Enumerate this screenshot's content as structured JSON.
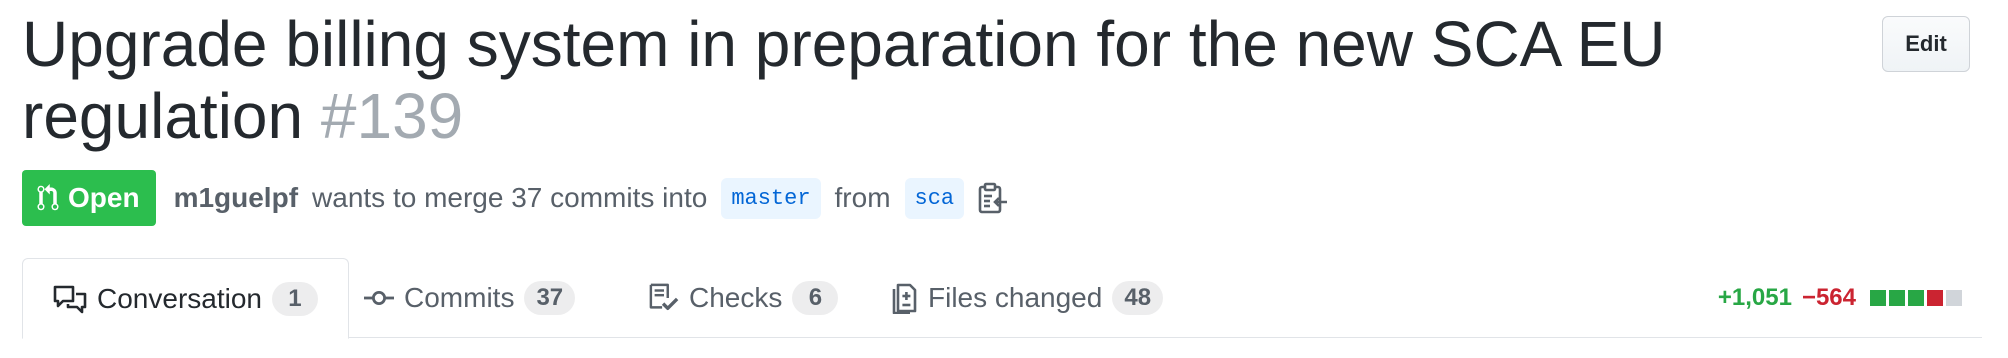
{
  "pr": {
    "title": "Upgrade billing system in preparation for the new SCA EU regulation",
    "number": "#139",
    "edit_label": "Edit",
    "state": "Open",
    "author": "m1guelpf",
    "merge_text": "wants to merge 37 commits into",
    "base_branch": "master",
    "from_text": "from",
    "head_branch": "sca"
  },
  "tabs": [
    {
      "label": "Conversation",
      "count": "1",
      "icon": "comment-discussion-icon",
      "selected": true
    },
    {
      "label": "Commits",
      "count": "37",
      "icon": "git-commit-icon",
      "selected": false
    },
    {
      "label": "Checks",
      "count": "6",
      "icon": "checklist-icon",
      "selected": false
    },
    {
      "label": "Files changed",
      "count": "48",
      "icon": "file-diff-icon",
      "selected": false
    }
  ],
  "diffstat": {
    "additions": "+1,051",
    "deletions": "−564",
    "blocks": [
      "green",
      "green",
      "green",
      "red",
      "gray"
    ]
  },
  "colors": {
    "open_green": "#2cbe4e",
    "additions": "#28a745",
    "deletions": "#cb2431",
    "neutral": "#d1d5da",
    "link_blue": "#0366d6"
  }
}
